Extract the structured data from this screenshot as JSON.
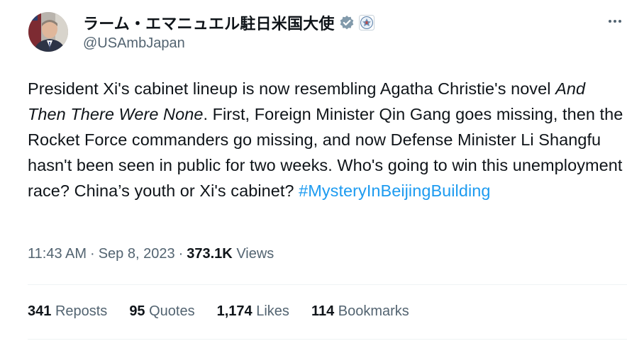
{
  "author": {
    "display_name": "ラーム・エマニュエル駐日米国大使",
    "handle": "@USAmbJapan",
    "verified_color": "#829aab"
  },
  "tweet": {
    "text_part1": "President Xi's cabinet lineup is now resembling Agatha Christie's novel ",
    "text_italic": "And Then There Were None",
    "text_part2": ". First, Foreign Minister Qin Gang goes missing, then the Rocket Force commanders go missing, and now Defense Minister Li Shangfu hasn't been seen in public for two weeks. Who's going to win this unemployment race? China’s youth or Xi's cabinet?  ",
    "hashtag": "#MysteryInBeijingBuilding"
  },
  "meta": {
    "time": "11:43 AM",
    "separator": "·",
    "date": "Sep 8, 2023",
    "views_count": "373.1K",
    "views_label": "Views"
  },
  "stats": {
    "reposts_count": "341",
    "reposts_label": "Reposts",
    "quotes_count": "95",
    "quotes_label": "Quotes",
    "likes_count": "1,174",
    "likes_label": "Likes",
    "bookmarks_count": "114",
    "bookmarks_label": "Bookmarks"
  },
  "colors": {
    "text": "#0f1419",
    "secondary": "#536471",
    "link": "#1d9bf0",
    "divider": "#eff3f4"
  }
}
